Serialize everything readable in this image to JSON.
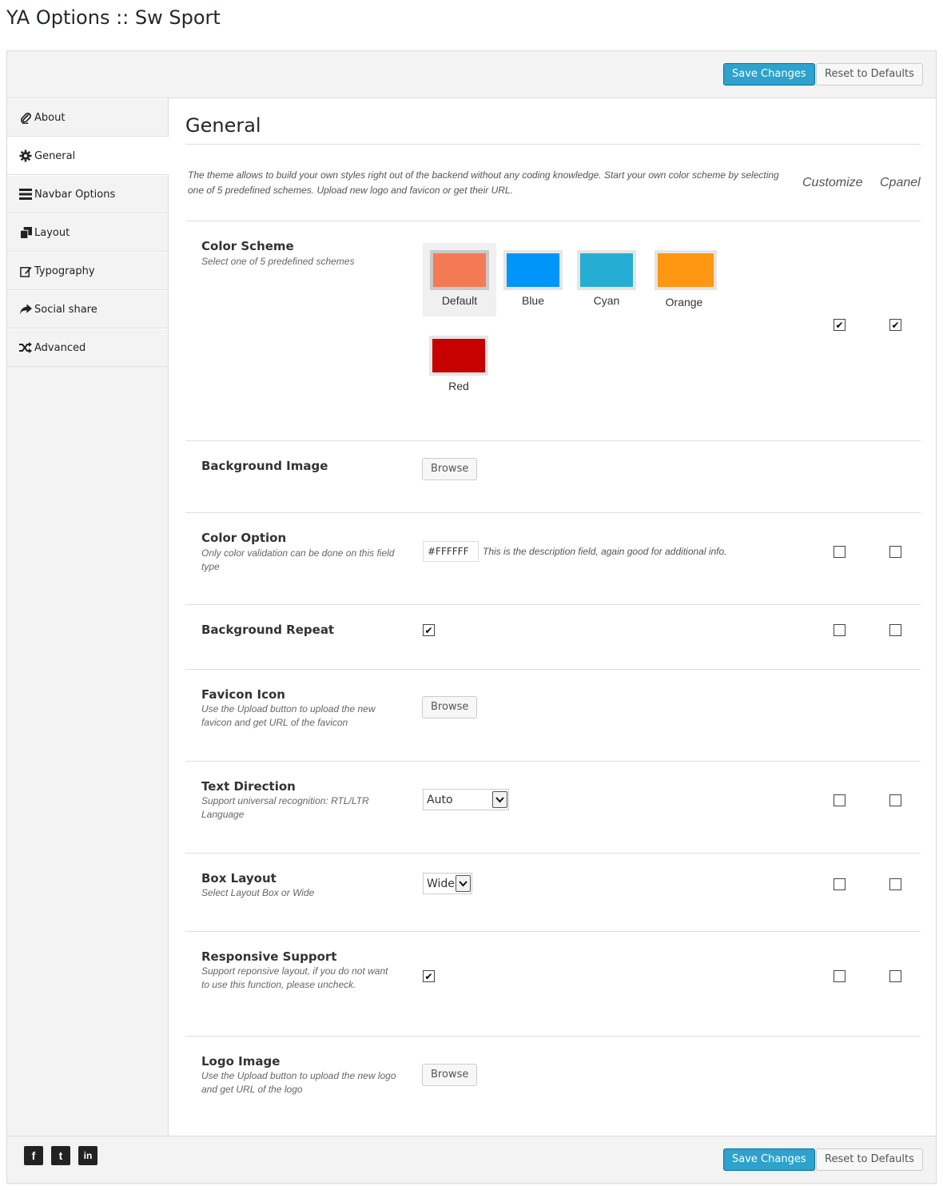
{
  "page": {
    "title": "YA Options :: Sw Sport"
  },
  "toolbar": {
    "save_label": "Save Changes",
    "reset_label": "Reset to Defaults"
  },
  "sidebar": {
    "items": [
      {
        "label": "About",
        "icon": "paperclip-icon"
      },
      {
        "label": "General",
        "icon": "gear-icon",
        "active": true
      },
      {
        "label": "Navbar Options",
        "icon": "menu-icon"
      },
      {
        "label": "Layout",
        "icon": "copy-icon"
      },
      {
        "label": "Typography",
        "icon": "edit-icon"
      },
      {
        "label": "Social share",
        "icon": "share-icon"
      },
      {
        "label": "Advanced",
        "icon": "shuffle-icon"
      }
    ]
  },
  "main": {
    "title": "General",
    "intro": "The theme allows to build your own styles right out of the backend without any coding knowledge. Start your own color scheme by selecting one of 5 predefined schemes. Upload new logo and favicon or get their URL.",
    "col_customize": "Customize",
    "col_cpanel": "Cpanel",
    "browse_label": "Browse",
    "color_scheme": {
      "label": "Color Scheme",
      "desc": "Select one of 5 predefined schemes",
      "swatches": [
        {
          "name": "Default",
          "color": "#f47a55",
          "selected": true
        },
        {
          "name": "Blue",
          "color": "#0096f9"
        },
        {
          "name": "Cyan",
          "color": "#26add3"
        },
        {
          "name": "Orange",
          "color": "#ff9712"
        },
        {
          "name": "Red",
          "color": "#c70000"
        }
      ],
      "customize": true,
      "cpanel": true
    },
    "background_image": {
      "label": "Background Image"
    },
    "color_option": {
      "label": "Color Option",
      "desc": "Only color validation can be done on this field type",
      "value": "#FFFFFF",
      "field_desc": "This is the description field, again good for additional info.",
      "customize": false,
      "cpanel": false
    },
    "background_repeat": {
      "label": "Background Repeat",
      "checked": true,
      "customize": false,
      "cpanel": false
    },
    "favicon": {
      "label": "Favicon Icon",
      "desc": "Use the Upload button to upload the new favicon and get URL of the favicon"
    },
    "text_direction": {
      "label": "Text Direction",
      "desc": "Support universal recognition: RTL/LTR Language",
      "value": "Auto",
      "customize": false,
      "cpanel": false
    },
    "box_layout": {
      "label": "Box Layout",
      "desc": "Select Layout Box or Wide",
      "value": "Wide",
      "customize": false,
      "cpanel": false
    },
    "responsive": {
      "label": "Responsive Support",
      "desc": "Support reponsive layout, if you do not want to use this function, please uncheck.",
      "checked": true,
      "customize": false,
      "cpanel": false
    },
    "logo": {
      "label": "Logo Image",
      "desc": "Use the Upload button to upload the new logo and get URL of the logo"
    }
  },
  "footer": {
    "social": [
      {
        "icon": "facebook-icon",
        "glyph": "f"
      },
      {
        "icon": "twitter-icon",
        "glyph": "t"
      },
      {
        "icon": "linkedin-icon",
        "glyph": "in"
      }
    ]
  },
  "colors": {
    "primary": "#2ea2cc",
    "panel_bg": "#f3f3f3",
    "border": "#dcdcdc"
  }
}
